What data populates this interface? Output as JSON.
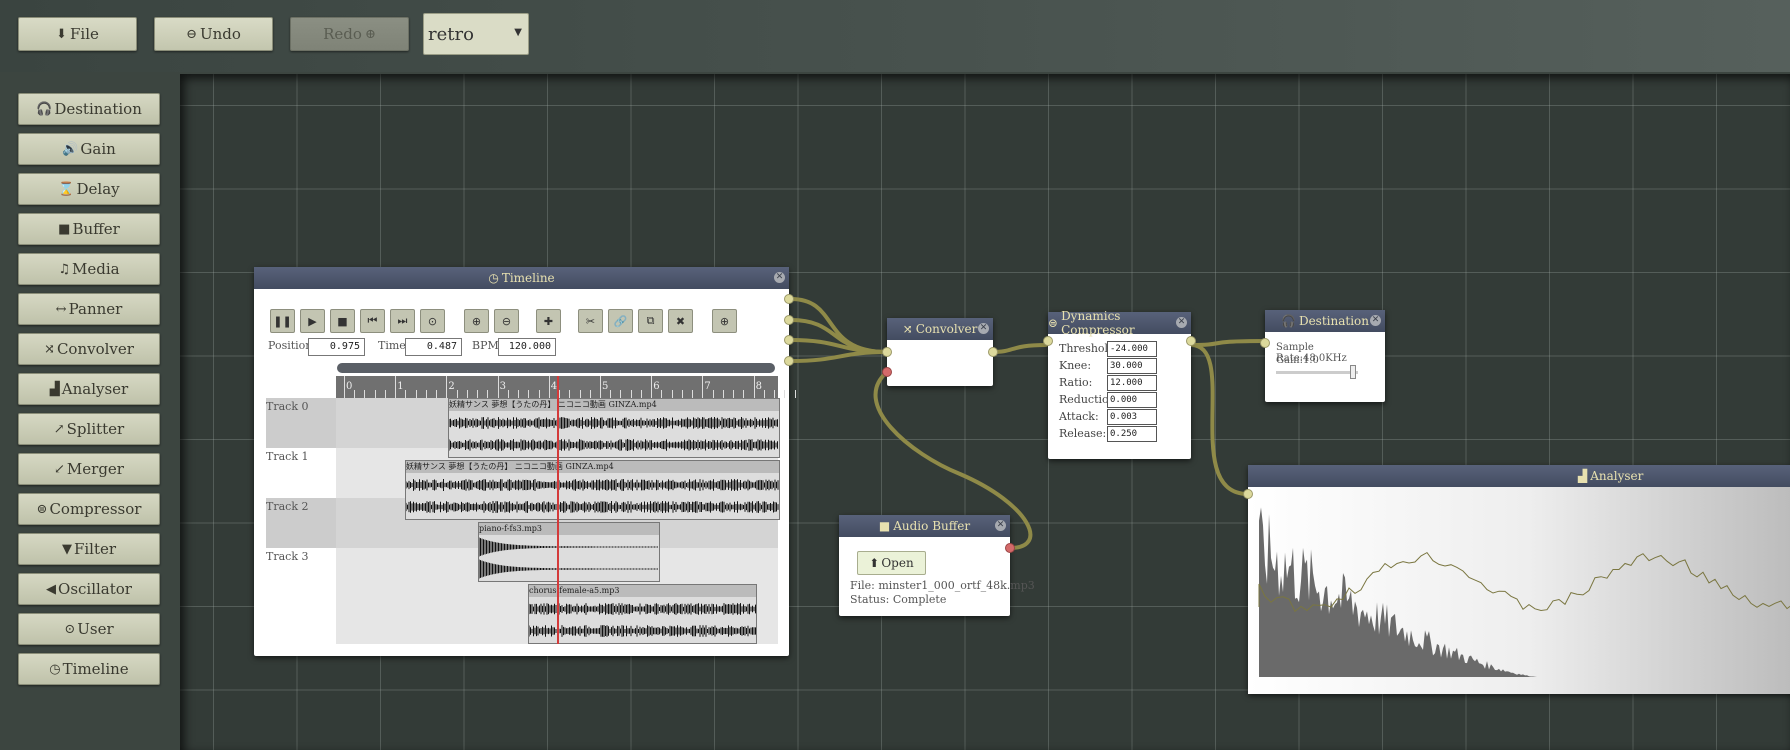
{
  "toolbar": {
    "file_label": "File",
    "undo_label": "Undo",
    "redo_label": "Redo",
    "theme_select": "retro"
  },
  "sidebar": {
    "items": [
      {
        "label": "Destination",
        "icon": "headphones-icon",
        "glyph": "🎧"
      },
      {
        "label": "Gain",
        "icon": "volume-icon",
        "glyph": "🔊"
      },
      {
        "label": "Delay",
        "icon": "hourglass-icon",
        "glyph": "⌛"
      },
      {
        "label": "Buffer",
        "icon": "film-icon",
        "glyph": "■"
      },
      {
        "label": "Media",
        "icon": "music-icon",
        "glyph": "♫"
      },
      {
        "label": "Panner",
        "icon": "arrows-horizontal-icon",
        "glyph": "↔"
      },
      {
        "label": "Convolver",
        "icon": "shuffle-icon",
        "glyph": "⤨"
      },
      {
        "label": "Analyser",
        "icon": "bar-chart-icon",
        "glyph": "▟"
      },
      {
        "label": "Splitter",
        "icon": "expand-icon",
        "glyph": "↗"
      },
      {
        "label": "Merger",
        "icon": "compress-icon",
        "glyph": "↙"
      },
      {
        "label": "Compressor",
        "icon": "compressor-icon",
        "glyph": "⊜"
      },
      {
        "label": "Filter",
        "icon": "filter-icon",
        "glyph": "▼"
      },
      {
        "label": "Oscillator",
        "icon": "bullhorn-icon",
        "glyph": "◀"
      },
      {
        "label": "User",
        "icon": "record-icon",
        "glyph": "⊙"
      },
      {
        "label": "Timeline",
        "icon": "clock-icon",
        "glyph": "◷"
      }
    ]
  },
  "timeline": {
    "title": "Timeline",
    "position_label": "Position:",
    "position_value": "0.975",
    "time_label": "Time:",
    "time_value": "0.487",
    "bpm_label": "BPM:",
    "bpm_value": "120.000",
    "ruler": [
      "0",
      "1",
      "2",
      "3",
      "4",
      "5",
      "6",
      "7",
      "8"
    ],
    "tracks": [
      "Track 0",
      "Track 1",
      "Track 2",
      "Track 3"
    ],
    "clips": [
      "妖精サンス 夢想【うたの丹】 ニコニコ動画 GINZA.mp4",
      "妖精サンス 夢想【うたの丹】 ニコニコ動画 GINZA.mp4",
      "piano-f-fs3.mp3",
      "chorus-female-a5.mp3"
    ]
  },
  "convolver": {
    "title": "Convolver"
  },
  "compressor": {
    "title": "Dynamics Compressor",
    "rows": [
      {
        "label": "Threshold:",
        "value": "-24.000"
      },
      {
        "label": "Knee:",
        "value": "30.000"
      },
      {
        "label": "Ratio:",
        "value": "12.000"
      },
      {
        "label": "Reduction:",
        "value": "0.000"
      },
      {
        "label": "Attack:",
        "value": "0.003"
      },
      {
        "label": "Release:",
        "value": "0.250"
      }
    ]
  },
  "destination": {
    "title": "Destination",
    "sample_rate": "Sample Rate:48.0KHz",
    "gain": "Gain:1.0",
    "gain_level": 1.0
  },
  "audio_buffer": {
    "title": "Audio Buffer",
    "open_label": "Open",
    "file": "File: minster1_000_ortf_48k.mp3",
    "status": "Status: Complete"
  },
  "analyser": {
    "title": "Analyser"
  },
  "colors": {
    "wire": "#8f8a48",
    "node_header": "#4b546a",
    "header_text": "#e8e1b0",
    "port": "#dcd99c"
  }
}
